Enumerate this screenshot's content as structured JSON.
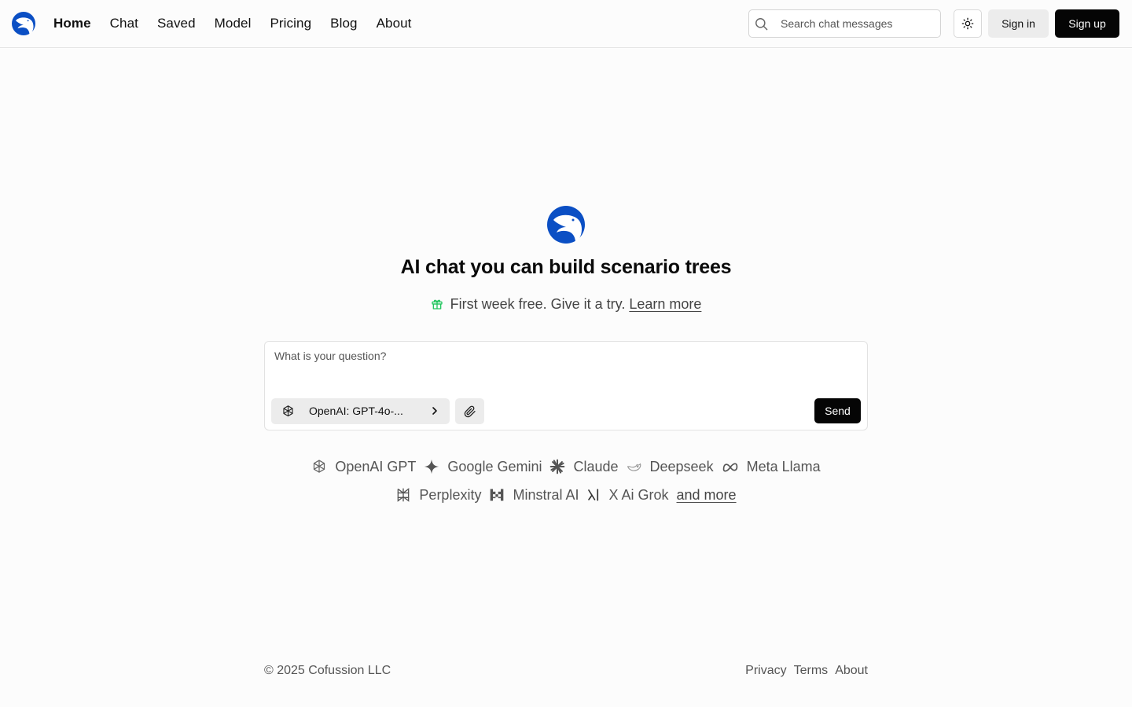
{
  "header": {
    "nav": [
      {
        "label": "Home",
        "active": true
      },
      {
        "label": "Chat"
      },
      {
        "label": "Saved"
      },
      {
        "label": "Model"
      },
      {
        "label": "Pricing"
      },
      {
        "label": "Blog"
      },
      {
        "label": "About"
      }
    ],
    "search_placeholder": "Search chat messages",
    "theme_icon": "sun-icon",
    "signin_label": "Sign in",
    "signup_label": "Sign up"
  },
  "hero": {
    "title": "AI chat you can build scenario trees",
    "promo_text": "First week free. Give it a try.",
    "promo_link": "Learn more",
    "gift_color": "#22c55e",
    "brand_color": "#0b4fc4"
  },
  "chat": {
    "placeholder": "What is your question?",
    "model_label": "OpenAI: GPT-4o-...",
    "send_label": "Send"
  },
  "providers": {
    "row1": [
      "OpenAI GPT",
      "Google Gemini",
      "Claude",
      "Deepseek",
      "Meta Llama"
    ],
    "row2": [
      "Perplexity",
      "Minstral AI",
      "X Ai Grok"
    ],
    "more_link": "and more"
  },
  "footer": {
    "copyright": "© 2025 Cofussion LLC",
    "links": [
      "Privacy",
      "Terms",
      "About"
    ]
  }
}
